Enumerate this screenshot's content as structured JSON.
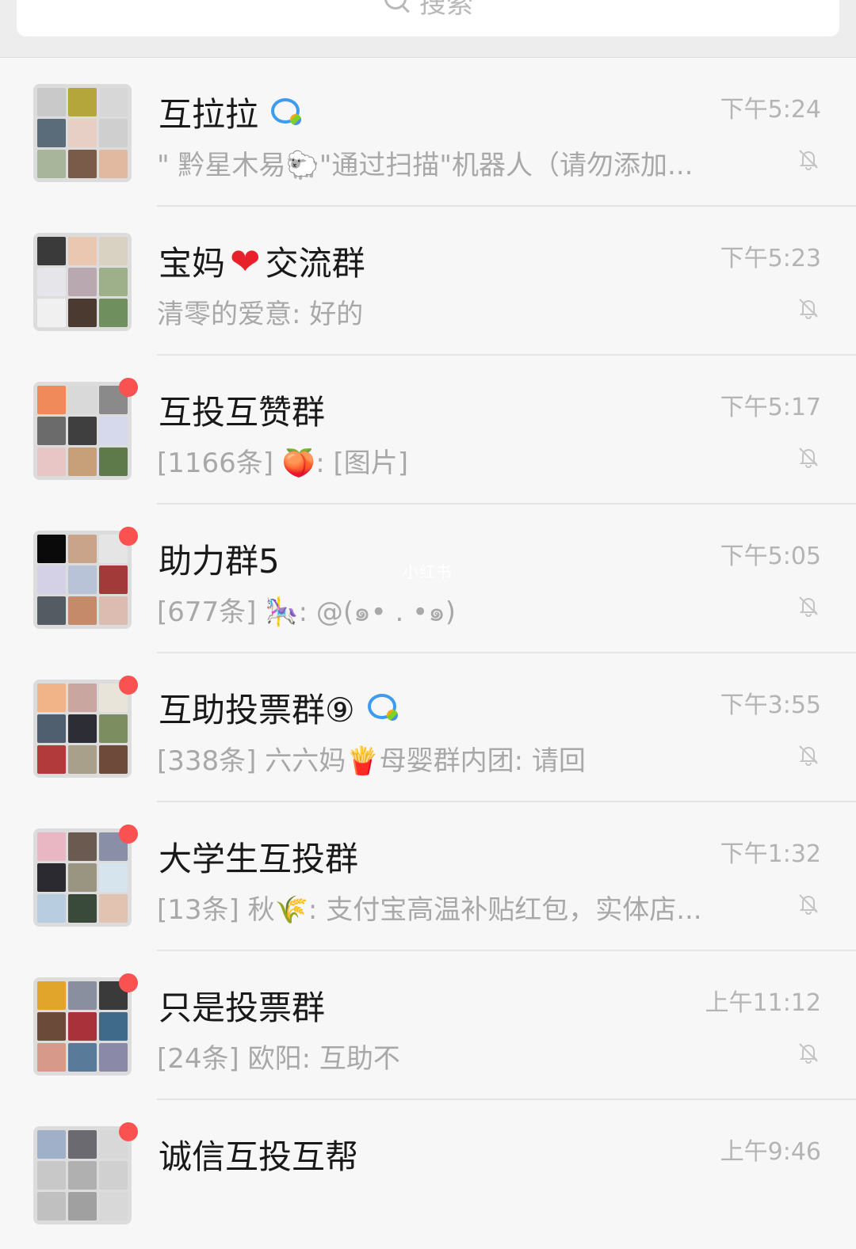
{
  "search": {
    "label": "搜索"
  },
  "watermark": "小红书",
  "chats": [
    {
      "name": "互拉拉",
      "badge": "bubble",
      "message": "\" 黔星木易🐑\"通过扫描\"机器人（请勿添加...",
      "time": "下午5:24",
      "unread": false
    },
    {
      "name_prefix": "宝妈",
      "name_suffix": "交流群",
      "badge": "heart",
      "message": "清零的爱意: 好的",
      "time": "下午5:23",
      "unread": false
    },
    {
      "name": "互投互赞群",
      "message": "[1166条] 🍑: [图片]",
      "time": "下午5:17",
      "unread": true
    },
    {
      "name": "助力群5",
      "message": "[677条] 🎠: @(๑• . •๑)",
      "time": "下午5:05",
      "unread": true
    },
    {
      "name": "互助投票群⑨",
      "badge": "bubble",
      "message": "[338条] 六六妈🍟母婴群内团: 请回",
      "time": "下午3:55",
      "unread": true
    },
    {
      "name": "大学生互投群",
      "message": "[13条] 秋🌾: 支付宝高温补贴红包，实体店...",
      "time": "下午1:32",
      "unread": true
    },
    {
      "name": "只是投票群",
      "message": "[24条] 欧阳: 互助不",
      "time": "上午11:12",
      "unread": true
    },
    {
      "name": "诚信互投互帮",
      "message": "",
      "time": "上午9:46",
      "unread": true
    }
  ]
}
